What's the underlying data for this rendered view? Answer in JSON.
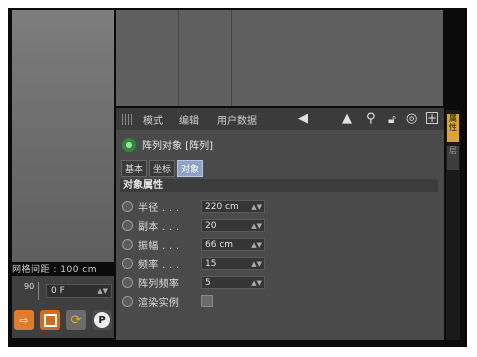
{
  "viewport": {
    "grid_spacing_label": "网格间距 : 100 cm"
  },
  "timeline": {
    "ruler_value": "90",
    "frame_value": "0 F"
  },
  "attributes_panel": {
    "menu": [
      "模式",
      "编辑",
      "用户数据"
    ],
    "object_name": "阵列对象 [阵列]",
    "tabs": [
      {
        "label": "基本",
        "active": false
      },
      {
        "label": "坐标",
        "active": false
      },
      {
        "label": "对象",
        "active": true
      }
    ],
    "section_title": "对象属性",
    "properties": [
      {
        "label": "半径 . . .",
        "value": "220 cm"
      },
      {
        "label": "副本 . . .",
        "value": "20"
      },
      {
        "label": "振幅 . . .",
        "value": "66 cm"
      },
      {
        "label": "频率 . . .",
        "value": "15"
      },
      {
        "label": "阵列频率",
        "value": "5"
      },
      {
        "label": "渲染实例",
        "value": ""
      }
    ]
  },
  "right_tabs": [
    "属性",
    "层"
  ],
  "colors": {
    "panel_bg": "#4a4a4a",
    "active_tab": "#8fa3c6",
    "accent_tab": "#d9a52a"
  }
}
